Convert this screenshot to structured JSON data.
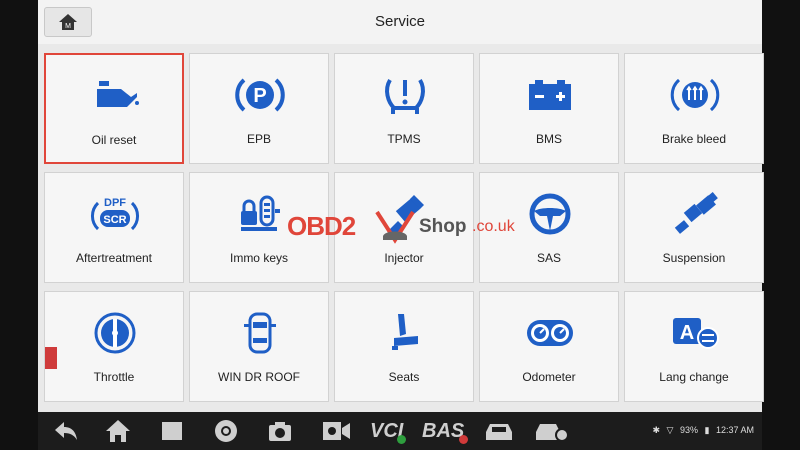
{
  "header": {
    "title": "Service"
  },
  "tiles": [
    {
      "label": "Oil reset",
      "icon": "oil-can-icon",
      "selected": true
    },
    {
      "label": "EPB",
      "icon": "parking-brake-icon"
    },
    {
      "label": "TPMS",
      "icon": "tire-pressure-icon"
    },
    {
      "label": "BMS",
      "icon": "battery-icon"
    },
    {
      "label": "Brake bleed",
      "icon": "brake-fluid-icon"
    },
    {
      "label": "Aftertreatment",
      "icon": "dpf-scr-icon"
    },
    {
      "label": "Immo keys",
      "icon": "immo-key-icon"
    },
    {
      "label": "Injector",
      "icon": "injector-icon"
    },
    {
      "label": "SAS",
      "icon": "steering-wheel-icon"
    },
    {
      "label": "Suspension",
      "icon": "suspension-icon"
    },
    {
      "label": "Throttle",
      "icon": "throttle-icon"
    },
    {
      "label": "WIN DR ROOF",
      "icon": "car-top-view-icon"
    },
    {
      "label": "Seats",
      "icon": "seat-icon"
    },
    {
      "label": "Odometer",
      "icon": "odometer-icon"
    },
    {
      "label": "Lang change",
      "icon": "language-icon"
    }
  ],
  "icons_text": {
    "epb": "P",
    "dpf": "DPF",
    "scr": "SCR",
    "lang": "A"
  },
  "watermark": {
    "part1": "OBD2",
    "part2": "Shop",
    "part3": ".co.uk"
  },
  "navbar": {
    "vci_label": "VCI",
    "bas_label": "BAS",
    "battery": "93%",
    "time": "12:37 AM"
  },
  "colors": {
    "accent": "#1f5fc6",
    "selected": "#e0463a"
  }
}
